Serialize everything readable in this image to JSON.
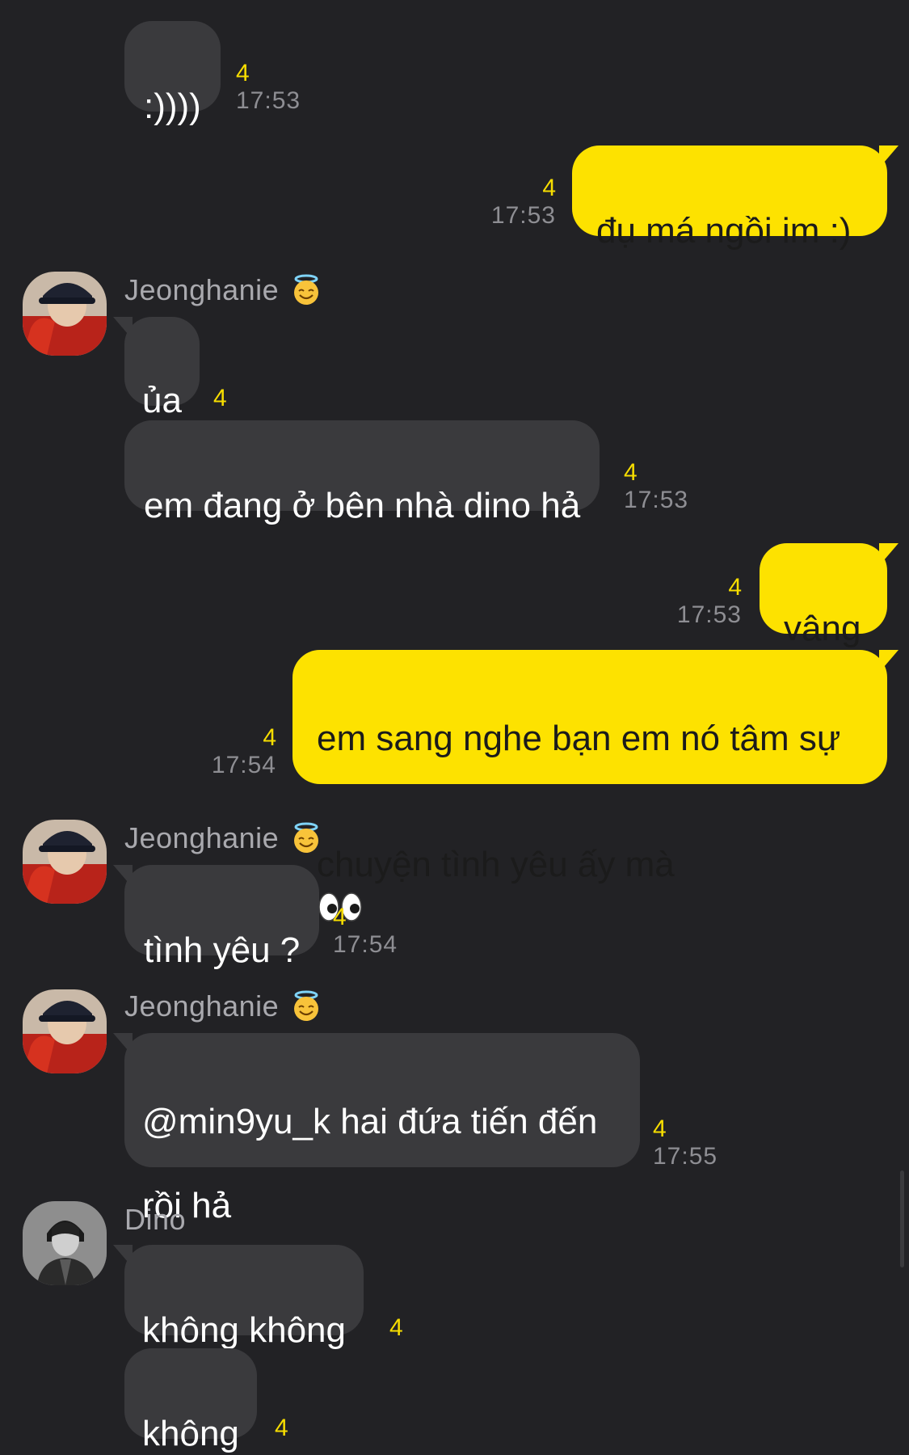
{
  "conversation": {
    "messages": [
      {
        "id": "m1",
        "text": ":))))",
        "unread": "4",
        "time": "17:53"
      },
      {
        "id": "m2",
        "text": "đụ má ngồi im :)",
        "unread": "4",
        "time": "17:53"
      },
      {
        "id": "m3",
        "sender": "Jeonghanie",
        "text": "ủa",
        "unread": "4"
      },
      {
        "id": "m4",
        "text": "em đang ở bên nhà dino hả",
        "unread": "4",
        "time": "17:53"
      },
      {
        "id": "m5",
        "text": "vâng",
        "unread": "4",
        "time": "17:53"
      },
      {
        "id": "m6",
        "text_line1": "em sang nghe bạn em nó tâm sự",
        "text_line2": "chuyện tình yêu ấy mà",
        "unread": "4",
        "time": "17:54"
      },
      {
        "id": "m7",
        "sender": "Jeonghanie",
        "text": "tình yêu ?",
        "unread": "4",
        "time": "17:54"
      },
      {
        "id": "m8",
        "sender": "Jeonghanie",
        "text_line1": "@min9yu_k hai đứa tiến đến",
        "text_line2": "rồi hả",
        "unread": "4",
        "time": "17:55"
      },
      {
        "id": "m9",
        "sender": "Dino",
        "text": "không không",
        "unread": "4"
      },
      {
        "id": "m10",
        "text": "không",
        "unread": "4"
      }
    ]
  },
  "icons": {
    "halo_emoji": "smiling-face-with-halo",
    "eyes_emoji": "eyes"
  },
  "colors": {
    "background": "#222225",
    "incoming_bubble": "#3a3a3d",
    "outgoing_bubble": "#fde200",
    "unread_count": "#f7dd00",
    "timestamp": "#8e8e93",
    "sender_name": "#a9a9ae"
  }
}
